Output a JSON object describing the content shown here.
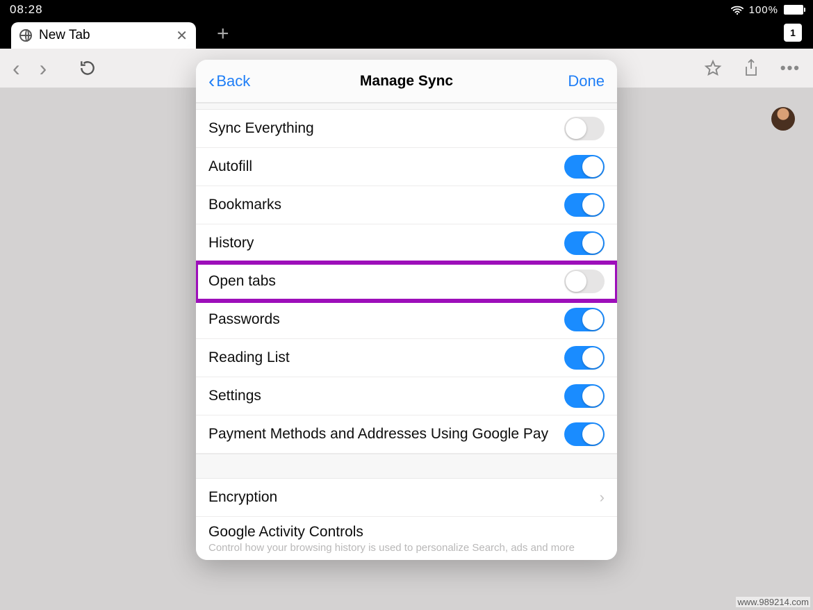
{
  "status": {
    "time": "08:28",
    "battery_pct": "100%"
  },
  "tab": {
    "title": "New Tab",
    "count": "1"
  },
  "sheet": {
    "back_label": "Back",
    "title": "Manage Sync",
    "done_label": "Done",
    "rows": {
      "sync_everything": {
        "label": "Sync Everything",
        "on": false
      },
      "autofill": {
        "label": "Autofill",
        "on": true
      },
      "bookmarks": {
        "label": "Bookmarks",
        "on": true
      },
      "history": {
        "label": "History",
        "on": true
      },
      "open_tabs": {
        "label": "Open tabs",
        "on": false,
        "highlighted": true
      },
      "passwords": {
        "label": "Passwords",
        "on": true
      },
      "reading_list": {
        "label": "Reading List",
        "on": true
      },
      "settings": {
        "label": "Settings",
        "on": true
      },
      "payments": {
        "label": "Payment Methods and Addresses Using Google Pay",
        "on": true
      }
    },
    "encryption_label": "Encryption",
    "activity": {
      "title": "Google Activity Controls",
      "subtitle": "Control how your browsing history is used to personalize Search, ads and more"
    }
  },
  "watermark": "www.989214.com"
}
